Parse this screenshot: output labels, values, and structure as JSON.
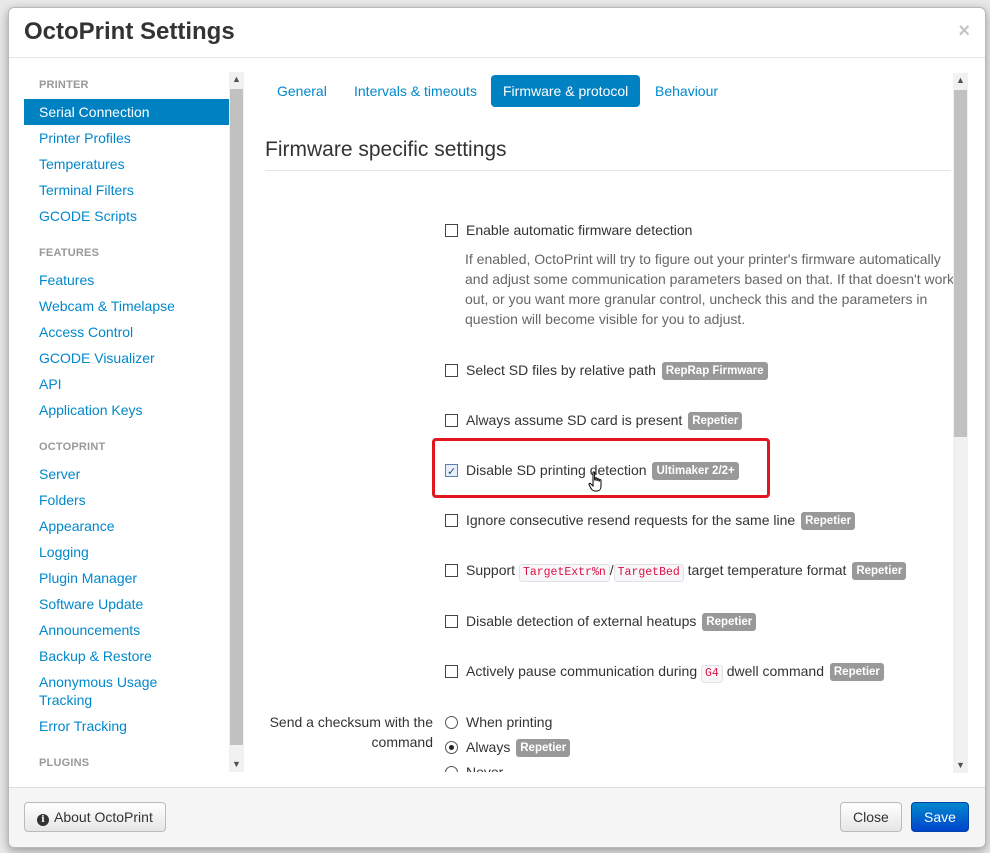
{
  "modal": {
    "title": "OctoPrint Settings",
    "close_symbol": "×"
  },
  "sidebar": {
    "groups": [
      {
        "header": "PRINTER",
        "items": [
          "Serial Connection",
          "Printer Profiles",
          "Temperatures",
          "Terminal Filters",
          "GCODE Scripts"
        ]
      },
      {
        "header": "FEATURES",
        "items": [
          "Features",
          "Webcam & Timelapse",
          "Access Control",
          "GCODE Visualizer",
          "API",
          "Application Keys"
        ]
      },
      {
        "header": "OCTOPRINT",
        "items": [
          "Server",
          "Folders",
          "Appearance",
          "Logging",
          "Plugin Manager",
          "Software Update",
          "Announcements",
          "Backup & Restore",
          "Anonymous Usage Tracking",
          "Error Tracking"
        ]
      },
      {
        "header": "PLUGINS",
        "items": []
      }
    ],
    "active_item": "Serial Connection"
  },
  "tabs": [
    "General",
    "Intervals & timeouts",
    "Firmware & protocol",
    "Behaviour"
  ],
  "active_tab": "Firmware & protocol",
  "section": {
    "title": "Firmware specific settings"
  },
  "options": {
    "auto_detect": {
      "label": "Enable automatic firmware detection",
      "checked": false,
      "help": "If enabled, OctoPrint will try to figure out your printer's firmware automatically and adjust some communication parameters based on that. If that doesn't work out, or you want more granular control, uncheck this and the parameters in question will become visible for you to adjust."
    },
    "sd_relative": {
      "label": "Select SD files by relative path",
      "badge": "RepRap Firmware",
      "checked": false
    },
    "sd_always": {
      "label": "Always assume SD card is present",
      "badge": "Repetier",
      "checked": false
    },
    "sd_disable": {
      "label": "Disable SD printing detection",
      "badge": "Ultimaker 2/2+",
      "checked": true
    },
    "ignore_resend": {
      "label": "Ignore consecutive resend requests for the same line",
      "badge": "Repetier",
      "checked": false
    },
    "target_format": {
      "label_prefix": "Support",
      "code1": "TargetExtr%n",
      "separator": "/",
      "code2": "TargetBed",
      "label_suffix": "target temperature format",
      "badge": "Repetier",
      "checked": false
    },
    "ext_heatups": {
      "label": "Disable detection of external heatups",
      "badge": "Repetier",
      "checked": false
    },
    "dwell": {
      "label_prefix": "Actively pause communication during",
      "code": "G4",
      "label_suffix": "dwell command",
      "badge": "Repetier",
      "checked": false
    }
  },
  "checksum": {
    "label": "Send a checksum with the command",
    "options": [
      {
        "label": "When printing",
        "badge": "",
        "checked": false
      },
      {
        "label": "Always",
        "badge": "Repetier",
        "checked": true
      },
      {
        "label": "Never",
        "badge": "",
        "checked": false
      }
    ]
  },
  "footer": {
    "about_label": "About OctoPrint",
    "close_label": "Close",
    "save_label": "Save"
  },
  "colors": {
    "accent": "#0081c2",
    "link": "#0088cc",
    "badge": "#999999",
    "highlight": "#e0171f"
  }
}
